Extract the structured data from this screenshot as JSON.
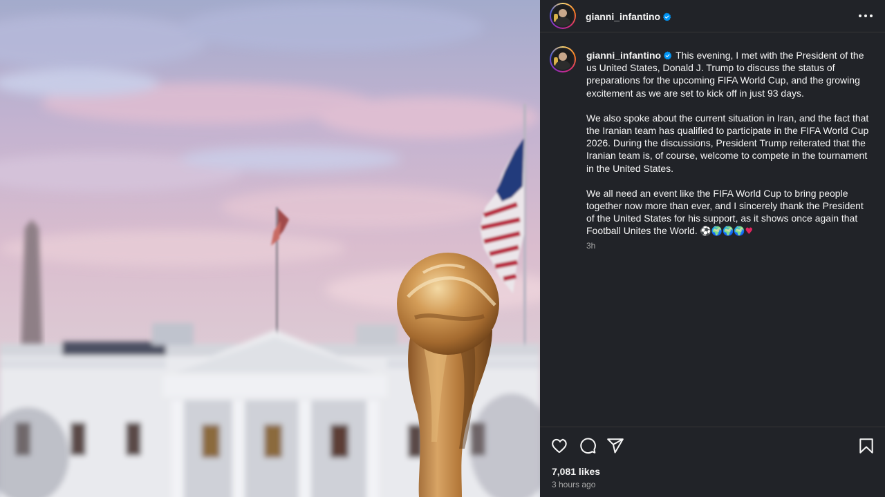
{
  "post": {
    "image_alt": "FIFA World Cup trophy in front of the White House at dusk",
    "username": "gianni_infantino",
    "verified": true,
    "caption_paragraphs": [
      "This evening, I met with the President of the us United States, Donald J. Trump to discuss the status of preparations for the upcoming FIFA World Cup, and the growing excitement as we are set to kick off in just 93 days.",
      "We also spoke about the current situation in Iran, and the fact that the Iranian team has qualified to participate in the FIFA World Cup 2026. During the discussions, President Trump reiterated that the Iranian team is, of course, welcome to compete in the tournament in the United States.",
      "We all need an event like the FIFA World Cup to bring people together now more than ever, and I sincerely thank the President of the United States for his support, as it shows once again that Football Unites the World."
    ],
    "caption_emojis": [
      "⚽",
      "🌍",
      "🌍",
      "🌍",
      "♥"
    ],
    "comment_time": "3h",
    "likes": "7,081 likes",
    "posted_ago": "3 hours ago"
  },
  "icons": {
    "like": "heart-icon",
    "comment": "comment-icon",
    "share": "share-icon",
    "save": "bookmark-icon",
    "more": "more-options-icon",
    "verified": "verified-badge-icon"
  },
  "colors": {
    "panel_bg": "#212328",
    "text": "#f5f5f5",
    "muted": "#a8a8a8",
    "verified": "#0095f6",
    "divider": "#363636"
  }
}
